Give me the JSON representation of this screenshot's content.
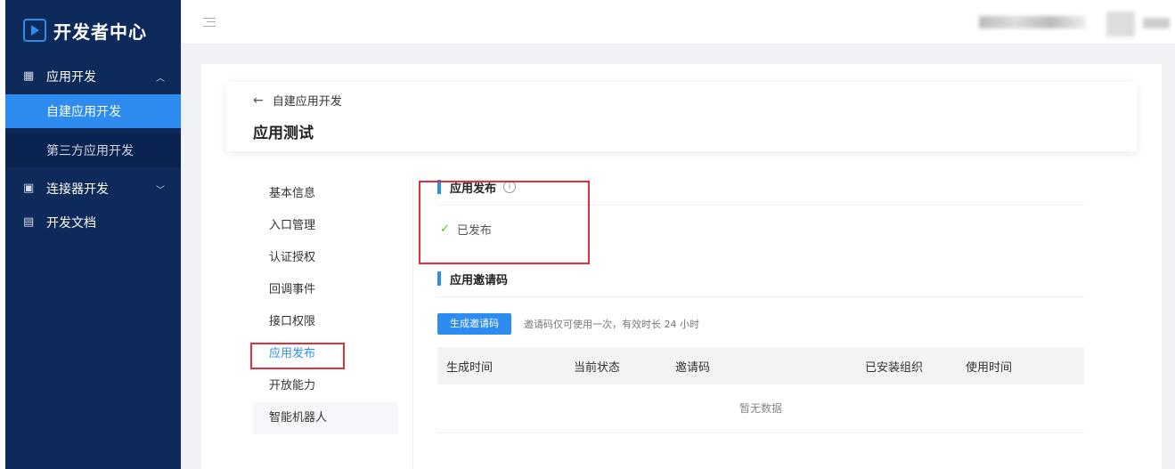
{
  "brand": {
    "title": "开发者中心"
  },
  "sidebar": {
    "groups": [
      {
        "label": "应用开发",
        "icon": "grid-icon",
        "expanded": true,
        "items": [
          {
            "label": "自建应用开发",
            "active": true
          },
          {
            "label": "第三方应用开发",
            "active": false
          }
        ]
      },
      {
        "label": "连接器开发",
        "icon": "box-icon",
        "expanded": false
      },
      {
        "label": "开发文档",
        "icon": "doc-icon",
        "expanded": false
      }
    ]
  },
  "header": {
    "back_label": "自建应用开发",
    "page_title": "应用测试"
  },
  "leftnav": {
    "items": [
      {
        "label": "基本信息"
      },
      {
        "label": "入口管理"
      },
      {
        "label": "认证授权"
      },
      {
        "label": "回调事件"
      },
      {
        "label": "接口权限"
      },
      {
        "label": "应用发布",
        "active": true
      },
      {
        "label": "开放能力"
      },
      {
        "label": "智能机器人"
      }
    ]
  },
  "publish": {
    "title": "应用发布",
    "status": "已发布"
  },
  "invite": {
    "title": "应用邀请码",
    "button": "生成邀请码",
    "tip": "邀请码仅可使用一次，有效时长 24 小时",
    "columns": [
      "生成时间",
      "当前状态",
      "邀请码",
      "已安装组织",
      "使用时间"
    ],
    "empty": "暂无数据"
  },
  "colors": {
    "sidebar_bg": "#0e2a5a",
    "accent": "#2e8cf0",
    "highlight": "#e0303a",
    "success": "#52c41a"
  }
}
